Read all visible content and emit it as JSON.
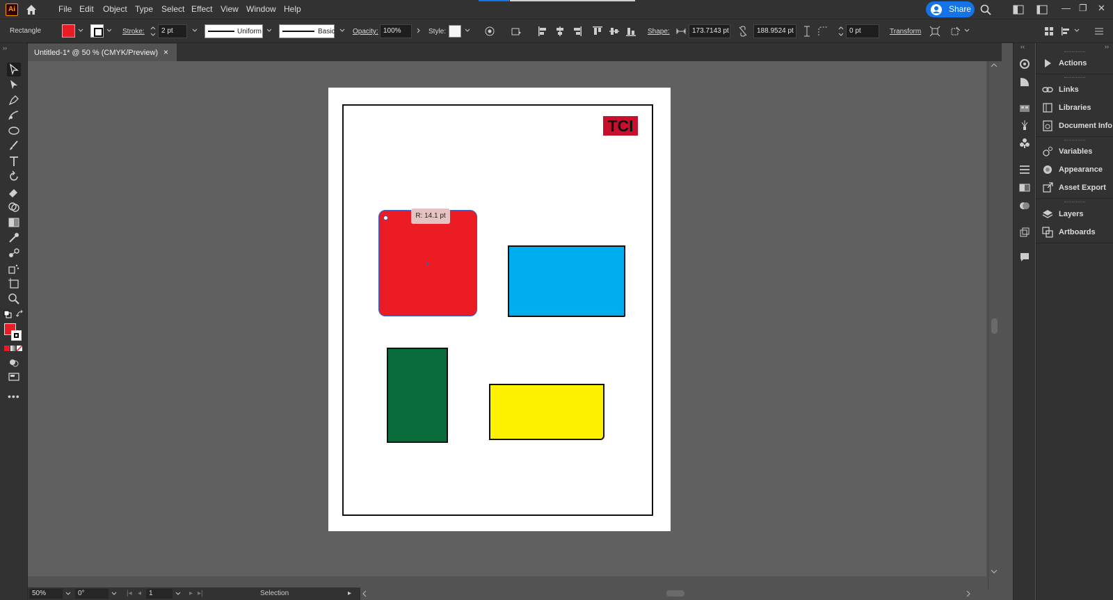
{
  "app": {
    "logo": "Ai",
    "menu": [
      "File",
      "Edit",
      "Object",
      "Type",
      "Select",
      "Effect",
      "View",
      "Window",
      "Help"
    ],
    "share_label": "Share"
  },
  "control_bar": {
    "tool_name": "Rectangle",
    "fill_color": "#e81c24",
    "stroke_label": "Stroke:",
    "stroke_weight": "2 pt",
    "variable_width_profile": "Uniform",
    "brush_definition": "Basic",
    "opacity_label": "Opacity:",
    "opacity_value": "100%",
    "style_label": "Style:",
    "shape_label": "Shape:",
    "shape_width": "173.7143 pt",
    "shape_height": "188.9524 pt",
    "corner_radius": "0 pt",
    "transform_label": "Transform"
  },
  "document": {
    "tab_title": "Untitled-1* @ 50 % (CMYK/Preview)",
    "close_glyph": "×"
  },
  "artboard": {
    "logo_text": "TCI",
    "logo_color": "#c8102e",
    "radius_tooltip": "R: 14.1 pt",
    "shapes": [
      {
        "name": "red-rectangle",
        "color": "#ec1c24",
        "selected": true
      },
      {
        "name": "blue-rectangle",
        "color": "#00aeef"
      },
      {
        "name": "green-rectangle",
        "color": "#0a6b3c"
      },
      {
        "name": "yellow-rectangle",
        "color": "#fff200"
      }
    ]
  },
  "status_bar": {
    "zoom": "50%",
    "rotation": "0°",
    "artboard_number": "1",
    "current_tool": "Selection"
  },
  "panels": [
    {
      "label": "Actions",
      "icon": "play-icon"
    },
    {
      "label": "Links",
      "icon": "link-icon"
    },
    {
      "label": "Libraries",
      "icon": "libraries-icon"
    },
    {
      "label": "Document Info",
      "icon": "info-icon"
    },
    {
      "label": "Variables",
      "icon": "variables-icon"
    },
    {
      "label": "Appearance",
      "icon": "appearance-icon"
    },
    {
      "label": "Asset Export",
      "icon": "export-icon"
    },
    {
      "label": "Layers",
      "icon": "layers-icon"
    },
    {
      "label": "Artboards",
      "icon": "artboards-icon"
    }
  ],
  "colors": {
    "accent": "#1473e6",
    "ui_dark": "#323232",
    "canvas": "#606060"
  }
}
